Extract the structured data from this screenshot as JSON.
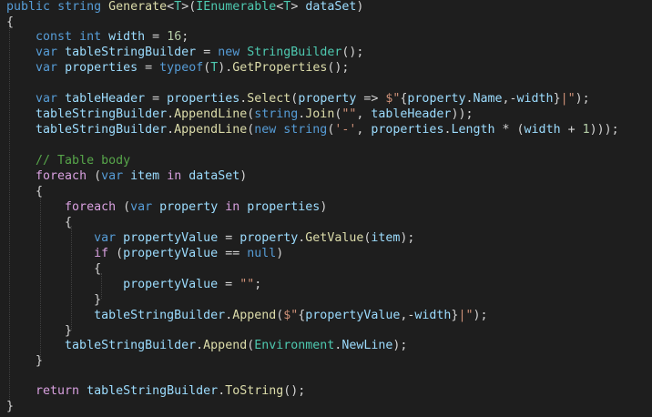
{
  "colors": {
    "background": "#1e1e1e",
    "default": "#d4d4d4",
    "keyword": "#569cd6",
    "control": "#d8a0df",
    "method": "#dcdcaa",
    "type": "#4ec9b0",
    "variable": "#9cdcfe",
    "string": "#ce9178",
    "number": "#b5cea8",
    "comment": "#57a64a",
    "escape": "#ffd68f"
  },
  "lines": [
    [
      [
        "keyword",
        "public"
      ],
      [
        "default",
        " "
      ],
      [
        "keyword",
        "string"
      ],
      [
        "default",
        " "
      ],
      [
        "method",
        "Generate"
      ],
      [
        "default",
        "<"
      ],
      [
        "type",
        "T"
      ],
      [
        "default",
        ">("
      ],
      [
        "type",
        "IEnumerable"
      ],
      [
        "default",
        "<"
      ],
      [
        "type",
        "T"
      ],
      [
        "default",
        "> "
      ],
      [
        "variable",
        "dataSet"
      ],
      [
        "default",
        ")"
      ]
    ],
    [
      [
        "default",
        "{"
      ]
    ],
    [
      [
        "default",
        "    "
      ],
      [
        "keyword",
        "const"
      ],
      [
        "default",
        " "
      ],
      [
        "keyword",
        "int"
      ],
      [
        "default",
        " "
      ],
      [
        "variable",
        "width"
      ],
      [
        "default",
        " = "
      ],
      [
        "number",
        "16"
      ],
      [
        "default",
        ";"
      ]
    ],
    [
      [
        "default",
        "    "
      ],
      [
        "keyword",
        "var"
      ],
      [
        "default",
        " "
      ],
      [
        "variable",
        "tableStringBuilder"
      ],
      [
        "default",
        " = "
      ],
      [
        "keyword",
        "new"
      ],
      [
        "default",
        " "
      ],
      [
        "type",
        "StringBuilder"
      ],
      [
        "default",
        "();"
      ]
    ],
    [
      [
        "default",
        "    "
      ],
      [
        "keyword",
        "var"
      ],
      [
        "default",
        " "
      ],
      [
        "variable",
        "properties"
      ],
      [
        "default",
        " = "
      ],
      [
        "keyword",
        "typeof"
      ],
      [
        "default",
        "("
      ],
      [
        "type",
        "T"
      ],
      [
        "default",
        ")."
      ],
      [
        "method",
        "GetProperties"
      ],
      [
        "default",
        "();"
      ]
    ],
    [],
    [
      [
        "default",
        "    "
      ],
      [
        "keyword",
        "var"
      ],
      [
        "default",
        " "
      ],
      [
        "variable",
        "tableHeader"
      ],
      [
        "default",
        " = "
      ],
      [
        "variable",
        "properties"
      ],
      [
        "default",
        "."
      ],
      [
        "method",
        "Select"
      ],
      [
        "default",
        "("
      ],
      [
        "variable",
        "property"
      ],
      [
        "default",
        " => "
      ],
      [
        "string",
        "$\""
      ],
      [
        "default",
        "{"
      ],
      [
        "variable",
        "property"
      ],
      [
        "default",
        "."
      ],
      [
        "variable",
        "Name"
      ],
      [
        "default",
        ",-"
      ],
      [
        "variable",
        "width"
      ],
      [
        "default",
        "}"
      ],
      [
        "string",
        "|\""
      ],
      [
        "default",
        ");"
      ]
    ],
    [
      [
        "default",
        "    "
      ],
      [
        "variable",
        "tableStringBuilder"
      ],
      [
        "default",
        "."
      ],
      [
        "method",
        "AppendLine"
      ],
      [
        "default",
        "("
      ],
      [
        "keyword",
        "string"
      ],
      [
        "default",
        "."
      ],
      [
        "method",
        "Join"
      ],
      [
        "default",
        "("
      ],
      [
        "string",
        "\"\""
      ],
      [
        "default",
        ", "
      ],
      [
        "variable",
        "tableHeader"
      ],
      [
        "default",
        "));"
      ]
    ],
    [
      [
        "default",
        "    "
      ],
      [
        "variable",
        "tableStringBuilder"
      ],
      [
        "default",
        "."
      ],
      [
        "method",
        "AppendLine"
      ],
      [
        "default",
        "("
      ],
      [
        "keyword",
        "new"
      ],
      [
        "default",
        " "
      ],
      [
        "keyword",
        "string"
      ],
      [
        "default",
        "("
      ],
      [
        "string",
        "'-'"
      ],
      [
        "default",
        ", "
      ],
      [
        "variable",
        "properties"
      ],
      [
        "default",
        "."
      ],
      [
        "variable",
        "Length"
      ],
      [
        "default",
        " * ("
      ],
      [
        "variable",
        "width"
      ],
      [
        "default",
        " + "
      ],
      [
        "number",
        "1"
      ],
      [
        "default",
        ")));"
      ]
    ],
    [],
    [
      [
        "default",
        "    "
      ],
      [
        "comment",
        "// Table body"
      ]
    ],
    [
      [
        "default",
        "    "
      ],
      [
        "control",
        "foreach"
      ],
      [
        "default",
        " ("
      ],
      [
        "keyword",
        "var"
      ],
      [
        "default",
        " "
      ],
      [
        "variable",
        "item"
      ],
      [
        "default",
        " "
      ],
      [
        "control",
        "in"
      ],
      [
        "default",
        " "
      ],
      [
        "variable",
        "dataSet"
      ],
      [
        "default",
        ")"
      ]
    ],
    [
      [
        "default",
        "    {"
      ]
    ],
    [
      [
        "default",
        "        "
      ],
      [
        "control",
        "foreach"
      ],
      [
        "default",
        " ("
      ],
      [
        "keyword",
        "var"
      ],
      [
        "default",
        " "
      ],
      [
        "variable",
        "property"
      ],
      [
        "default",
        " "
      ],
      [
        "control",
        "in"
      ],
      [
        "default",
        " "
      ],
      [
        "variable",
        "properties"
      ],
      [
        "default",
        ")"
      ]
    ],
    [
      [
        "default",
        "        {"
      ]
    ],
    [
      [
        "default",
        "            "
      ],
      [
        "keyword",
        "var"
      ],
      [
        "default",
        " "
      ],
      [
        "variable",
        "propertyValue"
      ],
      [
        "default",
        " = "
      ],
      [
        "variable",
        "property"
      ],
      [
        "default",
        "."
      ],
      [
        "method",
        "GetValue"
      ],
      [
        "default",
        "("
      ],
      [
        "variable",
        "item"
      ],
      [
        "default",
        ");"
      ]
    ],
    [
      [
        "default",
        "            "
      ],
      [
        "control",
        "if"
      ],
      [
        "default",
        " ("
      ],
      [
        "variable",
        "propertyValue"
      ],
      [
        "default",
        " == "
      ],
      [
        "keyword",
        "null"
      ],
      [
        "default",
        ")"
      ]
    ],
    [
      [
        "default",
        "            {"
      ]
    ],
    [
      [
        "default",
        "                "
      ],
      [
        "variable",
        "propertyValue"
      ],
      [
        "default",
        " = "
      ],
      [
        "string",
        "\"\""
      ],
      [
        "default",
        ";"
      ]
    ],
    [
      [
        "default",
        "            }"
      ]
    ],
    [
      [
        "default",
        "            "
      ],
      [
        "variable",
        "tableStringBuilder"
      ],
      [
        "default",
        "."
      ],
      [
        "method",
        "Append"
      ],
      [
        "default",
        "("
      ],
      [
        "string",
        "$\""
      ],
      [
        "default",
        "{"
      ],
      [
        "variable",
        "propertyValue"
      ],
      [
        "default",
        ",-"
      ],
      [
        "variable",
        "width"
      ],
      [
        "default",
        "}"
      ],
      [
        "string",
        "|\""
      ],
      [
        "default",
        ");"
      ]
    ],
    [
      [
        "default",
        "        }"
      ]
    ],
    [
      [
        "default",
        "        "
      ],
      [
        "variable",
        "tableStringBuilder"
      ],
      [
        "default",
        "."
      ],
      [
        "method",
        "Append"
      ],
      [
        "default",
        "("
      ],
      [
        "type",
        "Environment"
      ],
      [
        "default",
        "."
      ],
      [
        "variable",
        "NewLine"
      ],
      [
        "default",
        ");"
      ]
    ],
    [
      [
        "default",
        "    }"
      ]
    ],
    [],
    [
      [
        "default",
        "    "
      ],
      [
        "control",
        "return"
      ],
      [
        "default",
        " "
      ],
      [
        "variable",
        "tableStringBuilder"
      ],
      [
        "default",
        "."
      ],
      [
        "method",
        "ToString"
      ],
      [
        "default",
        "();"
      ]
    ],
    [
      [
        "default",
        "}"
      ]
    ]
  ]
}
